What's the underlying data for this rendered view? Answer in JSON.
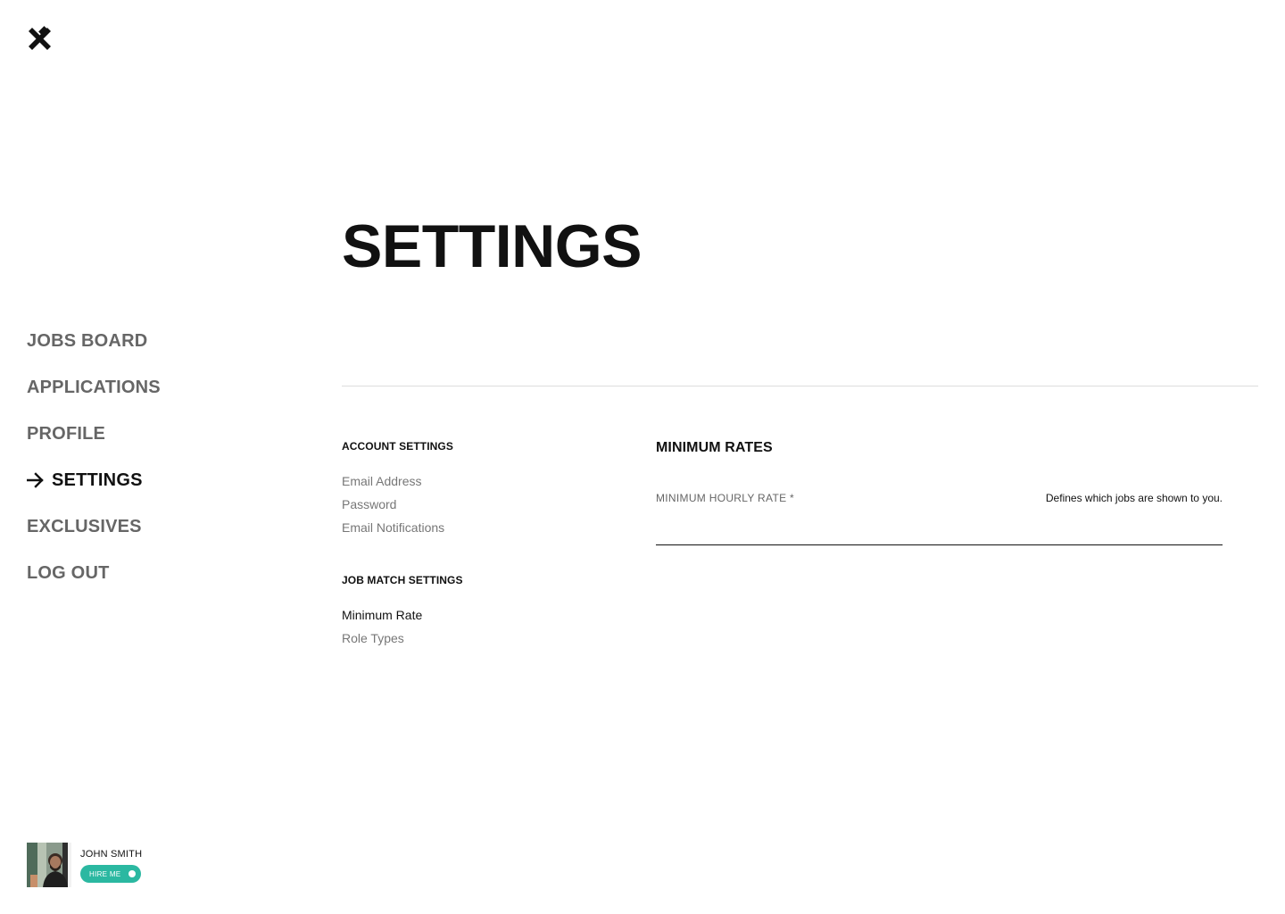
{
  "logo": {
    "icon": "brand-x-icon"
  },
  "nav": {
    "items": [
      {
        "label": "JOBS BOARD",
        "active": false
      },
      {
        "label": "APPLICATIONS",
        "active": false
      },
      {
        "label": "PROFILE",
        "active": false
      },
      {
        "label": "SETTINGS",
        "active": true
      },
      {
        "label": "EXCLUSIVES",
        "active": false
      },
      {
        "label": "LOG OUT",
        "active": false
      }
    ]
  },
  "page": {
    "title": "SETTINGS"
  },
  "settings_menu": {
    "account": {
      "heading": "ACCOUNT SETTINGS",
      "links": [
        "Email Address",
        "Password",
        "Email Notifications"
      ]
    },
    "job_match": {
      "heading": "JOB MATCH SETTINGS",
      "links": [
        "Minimum Rate",
        "Role Types"
      ],
      "active_link": "Minimum Rate"
    }
  },
  "panel": {
    "title": "MINIMUM RATES",
    "field": {
      "label": "MINIMUM HOURLY RATE *",
      "hint": "Defines which jobs are shown to you.",
      "value": ""
    }
  },
  "profile": {
    "name": "JOHN SMITH",
    "badge": "HIRE ME",
    "badge_color": "#2bb8a1"
  }
}
